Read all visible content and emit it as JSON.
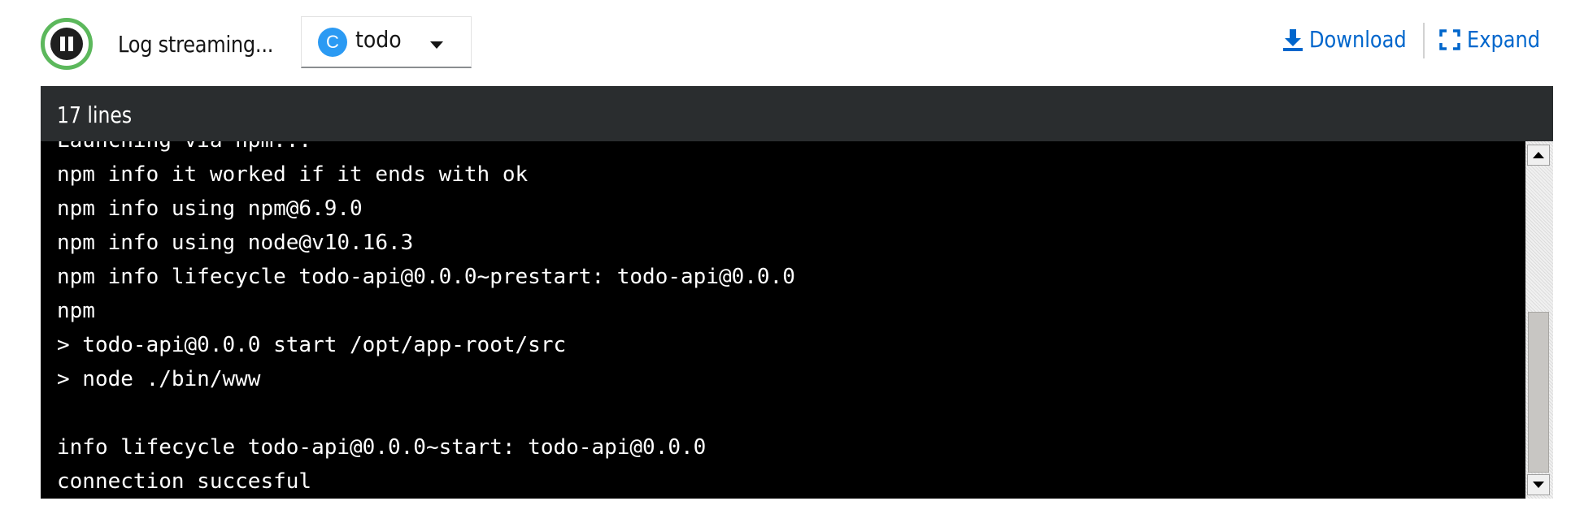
{
  "toolbar": {
    "pause_icon": "pause-icon",
    "status_text": "Log streaming...",
    "container_select": {
      "badge": "C",
      "selected": "todo",
      "badge_color": "#2b9af3"
    },
    "download_label": "Download",
    "expand_label": "Expand",
    "link_color": "#0066cc",
    "pause_ring_color": "#5cb85c"
  },
  "log": {
    "line_count": "17 lines",
    "lines": [
      "Launching via npm...",
      "npm info it worked if it ends with ok",
      "npm info using npm@6.9.0",
      "npm info using node@v10.16.3",
      "npm info lifecycle todo-api@0.0.0~prestart: todo-api@0.0.0",
      "npm",
      "> todo-api@0.0.0 start /opt/app-root/src",
      "> node ./bin/www",
      "",
      "info lifecycle todo-api@0.0.0~start: todo-api@0.0.0",
      "connection succesful"
    ]
  }
}
